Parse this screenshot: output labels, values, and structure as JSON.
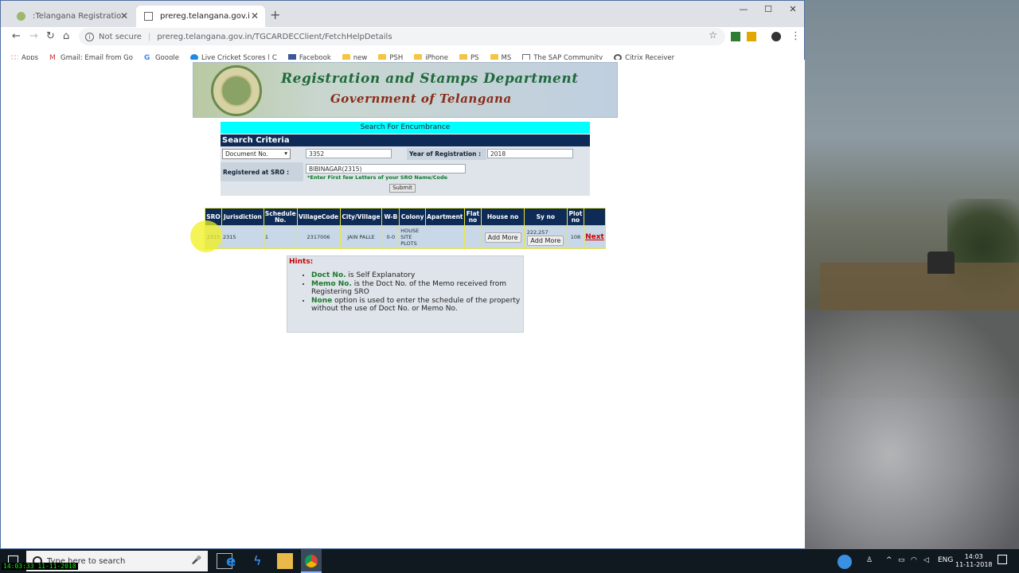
{
  "browser": {
    "tabs": [
      {
        "title": ":Telangana Registration & Stamp",
        "active": false
      },
      {
        "title": "prereg.telangana.gov.in/TGCARD",
        "active": true
      }
    ],
    "not_secure": "Not secure",
    "separator": "|",
    "url": "prereg.telangana.gov.in/TGCARDECClient/FetchHelpDetails",
    "bookmarks": [
      "Apps",
      "Gmail: Email from Go",
      "Google",
      "Live Cricket Scores | C",
      "Facebook",
      "new",
      "PSH",
      "iPhone",
      "PS",
      "MS",
      "The SAP Community",
      "Citrix Receiver"
    ]
  },
  "page": {
    "banner_title": "Registration and Stamps Department",
    "banner_subtitle": "Government of Telangana",
    "section_header": "Search For Encumbrance",
    "criteria_title": "Search Criteria",
    "doc_type": "Document No.",
    "doc_number": "3352",
    "year_label": "Year of Registration :",
    "year_value": "2018",
    "sro_label": "Registered at SRO :",
    "sro_value": "BIBINAGAR(2315)",
    "sro_hint": "*Enter First few Letters of your SRO Name/Code",
    "submit_label": "Submit"
  },
  "results": {
    "headers": [
      "SRO",
      "Jurisdiction",
      "Schedule No.",
      "VillageCode",
      "City/Village",
      "W-B",
      "Colony",
      "Apartment",
      "Flat no",
      "House no",
      "Sy no",
      "Plot no",
      ""
    ],
    "row": {
      "sro": "2315",
      "jurisdiction": "2315",
      "schedule": "1",
      "village_code": "2317006",
      "city": "JAIN PALLE",
      "wb": "0-0",
      "colony": "HOUSE SITE PLOTS",
      "apartment": "",
      "flat": "",
      "house_add": "Add More",
      "sy_value": "222,257",
      "sy_add": "Add More",
      "plot": "108",
      "next": "Next"
    }
  },
  "hints": {
    "title": "Hints:",
    "items": [
      {
        "key": "Doct No.",
        "text": " is Self Explanatory"
      },
      {
        "key": "Memo No.",
        "text": " is the Doct No. of the Memo received from Registering SRO"
      },
      {
        "key": "None",
        "text": " option is used to enter the schedule of the property without the use of Doct No. or Memo No."
      }
    ]
  },
  "taskbar": {
    "search_placeholder": "Type here to search",
    "lang": "ENG",
    "time": "14:03",
    "date": "11-11-2018",
    "recording_stamp": "14:03:33 11-11-2018"
  }
}
